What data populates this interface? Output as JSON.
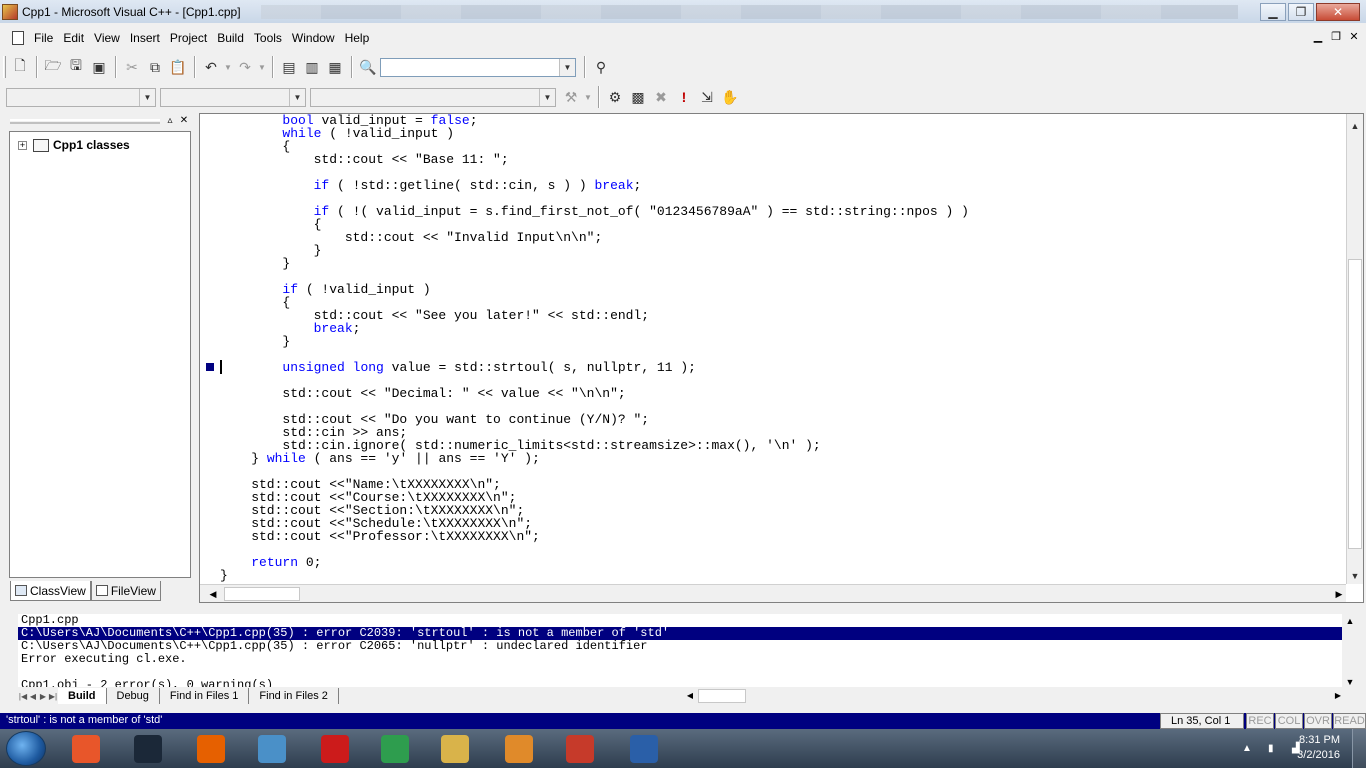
{
  "window": {
    "title": "Cpp1 - Microsoft Visual C++ - [Cpp1.cpp]",
    "controls": [
      "▁",
      "❐",
      "✕"
    ]
  },
  "menu": {
    "items": [
      "File",
      "Edit",
      "View",
      "Insert",
      "Project",
      "Build",
      "Tools",
      "Window",
      "Help"
    ],
    "mdi_controls": [
      "▁",
      "❐",
      "✕"
    ]
  },
  "toolbar": {
    "find_combo_value": ""
  },
  "workspace": {
    "tree_root_expander": "+",
    "tree_root_label": "Cpp1 classes",
    "tabs": [
      "ClassView",
      "FileView"
    ]
  },
  "editor": {
    "lines": [
      [
        [
          "        ",
          ""
        ],
        [
          "bool",
          "kw"
        ],
        [
          " valid_input = ",
          ""
        ],
        [
          "false",
          "kw"
        ],
        [
          ";",
          ""
        ]
      ],
      [
        [
          "        ",
          ""
        ],
        [
          "while",
          "kw"
        ],
        [
          " ( !valid_input )",
          ""
        ]
      ],
      [
        [
          "        {",
          ""
        ]
      ],
      [
        [
          "            std::cout << \"Base 11: \";",
          ""
        ]
      ],
      [
        [
          "",
          ""
        ]
      ],
      [
        [
          "            ",
          ""
        ],
        [
          "if",
          "kw"
        ],
        [
          " ( !std::getline( std::cin, s ) ) ",
          ""
        ],
        [
          "break",
          "kw"
        ],
        [
          ";",
          ""
        ]
      ],
      [
        [
          "",
          ""
        ]
      ],
      [
        [
          "            ",
          ""
        ],
        [
          "if",
          "kw"
        ],
        [
          " ( !( valid_input = s.find_first_not_of( \"0123456789aA\" ) == std::string::npos ) )",
          ""
        ]
      ],
      [
        [
          "            {",
          ""
        ]
      ],
      [
        [
          "                std::cout << \"Invalid Input\\n\\n\";",
          ""
        ]
      ],
      [
        [
          "            }",
          ""
        ]
      ],
      [
        [
          "        }",
          ""
        ]
      ],
      [
        [
          "",
          ""
        ]
      ],
      [
        [
          "        ",
          ""
        ],
        [
          "if",
          "kw"
        ],
        [
          " ( !valid_input )",
          ""
        ]
      ],
      [
        [
          "        {",
          ""
        ]
      ],
      [
        [
          "            std::cout << \"See you later!\" << std::endl;",
          ""
        ]
      ],
      [
        [
          "            ",
          ""
        ],
        [
          "break",
          "kw"
        ],
        [
          ";",
          ""
        ]
      ],
      [
        [
          "        }",
          ""
        ]
      ],
      [
        [
          "",
          ""
        ]
      ],
      [
        [
          "        ",
          ""
        ],
        [
          "unsigned",
          "kw"
        ],
        [
          " ",
          ""
        ],
        [
          "long",
          "kw"
        ],
        [
          " value = std::strtoul( s, nullptr, 11 );",
          ""
        ]
      ],
      [
        [
          "",
          ""
        ]
      ],
      [
        [
          "        std::cout << \"Decimal: \" << value << \"\\n\\n\";",
          ""
        ]
      ],
      [
        [
          "",
          ""
        ]
      ],
      [
        [
          "        std::cout << \"Do you want to continue (Y/N)? \";",
          ""
        ]
      ],
      [
        [
          "        std::cin >> ans;",
          ""
        ]
      ],
      [
        [
          "        std::cin.ignore( std::numeric_limits<std::streamsize>::max(), '\\n' );",
          ""
        ]
      ],
      [
        [
          "    } ",
          ""
        ],
        [
          "while",
          "kw"
        ],
        [
          " ( ans == 'y' || ans == 'Y' );",
          ""
        ]
      ],
      [
        [
          "",
          ""
        ]
      ],
      [
        [
          "    std::cout <<\"Name:\\tXXXXXXXX\\n\";",
          ""
        ]
      ],
      [
        [
          "    std::cout <<\"Course:\\tXXXXXXXX\\n\";",
          ""
        ]
      ],
      [
        [
          "    std::cout <<\"Section:\\tXXXXXXXX\\n\";",
          ""
        ]
      ],
      [
        [
          "    std::cout <<\"Schedule:\\tXXXXXXXX\\n\";",
          ""
        ]
      ],
      [
        [
          "    std::cout <<\"Professor:\\tXXXXXXXX\\n\";",
          ""
        ]
      ],
      [
        [
          "",
          ""
        ]
      ],
      [
        [
          "    ",
          ""
        ],
        [
          "return",
          "kw"
        ],
        [
          " 0;",
          ""
        ]
      ],
      [
        [
          "}",
          ""
        ]
      ]
    ]
  },
  "output": {
    "lines": [
      "Cpp1.cpp",
      "C:\\Users\\AJ\\Documents\\C++\\Cpp1.cpp(35) : error C2039: 'strtoul' : is not a member of 'std'",
      "C:\\Users\\AJ\\Documents\\C++\\Cpp1.cpp(35) : error C2065: 'nullptr' : undeclared identifier",
      "Error executing cl.exe.",
      "",
      "Cpp1.obj - 2 error(s), 0 warning(s)"
    ],
    "selected_index": 1,
    "tabs": [
      "Build",
      "Debug",
      "Find in Files 1",
      "Find in Files 2"
    ],
    "active_tab": 0
  },
  "status": {
    "message": "'strtoul' : is not a member of 'std'",
    "position": "Ln 35, Col 1",
    "indicators": [
      "REC",
      "COL",
      "OVR",
      "READ"
    ]
  },
  "taskbar": {
    "time": "8:31 PM",
    "date": "3/2/2016",
    "apps": [
      {
        "name": "apps-grid",
        "color": "#e8562a"
      },
      {
        "name": "steam",
        "color": "#1b2838"
      },
      {
        "name": "firefox",
        "color": "#e66000"
      },
      {
        "name": "chromium",
        "color": "#4a90c8"
      },
      {
        "name": "opera",
        "color": "#cc1b1b"
      },
      {
        "name": "chrome",
        "color": "#2e9d4e"
      },
      {
        "name": "file-explorer",
        "color": "#d9b34a"
      },
      {
        "name": "media-player",
        "color": "#e08a2a"
      },
      {
        "name": "visual-cpp",
        "color": "#c63a2a"
      },
      {
        "name": "visual-studio-tools",
        "color": "#2a5fa8"
      }
    ]
  }
}
